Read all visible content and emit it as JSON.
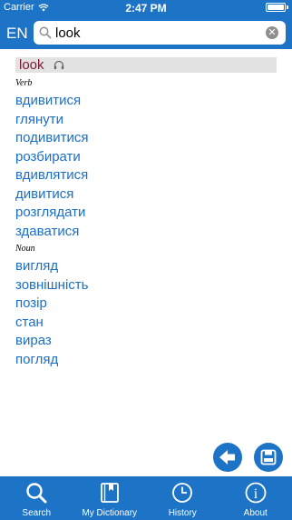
{
  "status_bar": {
    "carrier": "Carrier",
    "time": "2:47 PM",
    "battery_level": 1.0
  },
  "header": {
    "language": "EN",
    "search": {
      "value": "look",
      "placeholder": ""
    }
  },
  "entry": {
    "headword": "look",
    "sections": [
      {
        "pos": "Verb",
        "translations": [
          "вдивитися",
          "глянути",
          "подивитися",
          "розбирати",
          "вдивлятися",
          "дивитися",
          "розглядати",
          "здаватися"
        ]
      },
      {
        "pos": "Noun",
        "translations": [
          "вигляд",
          "зовнішність",
          "позір",
          "стан",
          "вираз",
          "погляд"
        ]
      }
    ]
  },
  "tabs": [
    {
      "label": "Search",
      "icon": "search-icon"
    },
    {
      "label": "My Dictionary",
      "icon": "book-icon"
    },
    {
      "label": "History",
      "icon": "clock-icon"
    },
    {
      "label": "About",
      "icon": "info-icon"
    }
  ],
  "colors": {
    "accent": "#1d73c6",
    "translation": "#1a6fc7",
    "headword": "#7a1830"
  }
}
